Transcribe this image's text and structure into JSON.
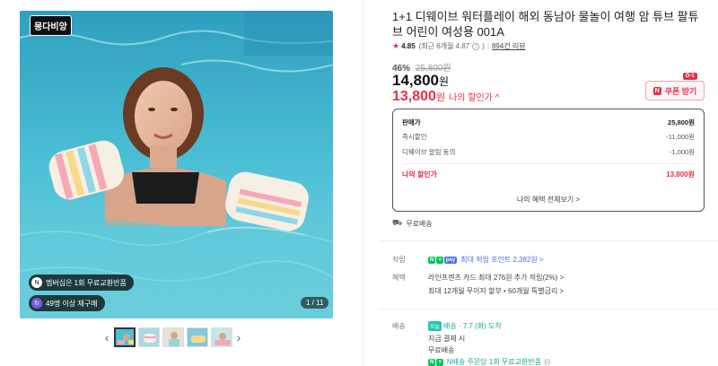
{
  "gallery": {
    "brand_badge": "몽다비앙",
    "pill_membership": "멤버십은 1회 무료교환반품",
    "pill_reorder": "49명 이상 재구매",
    "counter": "1 / 11",
    "prev_arrow": "‹",
    "next_arrow": "›"
  },
  "product": {
    "title": "1+1 디웨이브 워터플레이 해외 동남아 물놀이 여행 암 튜브 팔튜브 어린이 여성용 001A",
    "rating": "4.85",
    "rating_recent": "(최근 6개월 4.87",
    "rating_info": "i",
    "rating_close": ")",
    "reviews": "894건 리뷰",
    "discount_pct": "46%",
    "original_price": "25,800원",
    "price_num": "14,800",
    "price_unit": "원",
    "my_price_num": "13,800",
    "my_price_unit": "원",
    "my_price_label": "나의 할인가 ^",
    "coupon_badge": "N",
    "coupon_label": "쿠폰 받기",
    "dday": "D-1"
  },
  "price_box": {
    "rows": [
      {
        "label": "판매가",
        "value": "25,800원"
      },
      {
        "label": "즉시할인",
        "value": "-11,000원"
      },
      {
        "label": "디웨이브 알림 동의",
        "value": "-1,000원"
      },
      {
        "label": "나의 할인가",
        "value": "13,800원"
      }
    ],
    "link": "나의 혜택 전체보기 >"
  },
  "shipping": {
    "free": "무료배송",
    "truck_icon": "truck-icon"
  },
  "points": {
    "label": "적립",
    "tag_n": "N",
    "tag_plus": "+",
    "tag_pay": "pay",
    "text": "최대 적립 포인트 2,382원 >"
  },
  "benefits": {
    "label": "혜택",
    "line1": "라인프렌즈 카드 최대 276원 추가 적립(2%) >",
    "line2": "최대 12개월 무이자 할부 • 60개월 특별금리 >"
  },
  "delivery": {
    "label": "배송",
    "tag": "오늘",
    "arrive": "배송 · 7.7.(화) 도착",
    "line2": "지금 결제 시",
    "line3": "무료배송",
    "tag_n": "N",
    "tag_plus": "+",
    "line4": "N배송 주문당 1회 무료교환반품",
    "info": "(i)"
  },
  "colors": {
    "accent": "#e8304a",
    "naver_green": "#03c75a",
    "point_blue": "#4b6ef5"
  }
}
